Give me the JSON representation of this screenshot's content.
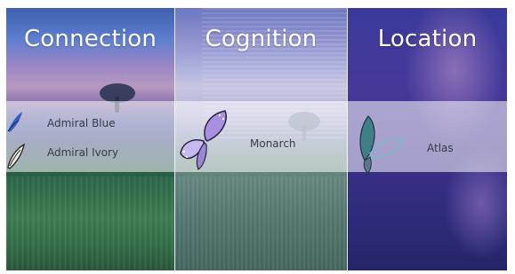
{
  "panels": [
    {
      "title": "Connection"
    },
    {
      "title": "Cognition"
    },
    {
      "title": "Location"
    }
  ],
  "butterflies": {
    "admiral_blue": "Admiral Blue",
    "admiral_ivory": "Admiral Ivory",
    "monarch": "Monarch",
    "atlas": "Atlas"
  }
}
